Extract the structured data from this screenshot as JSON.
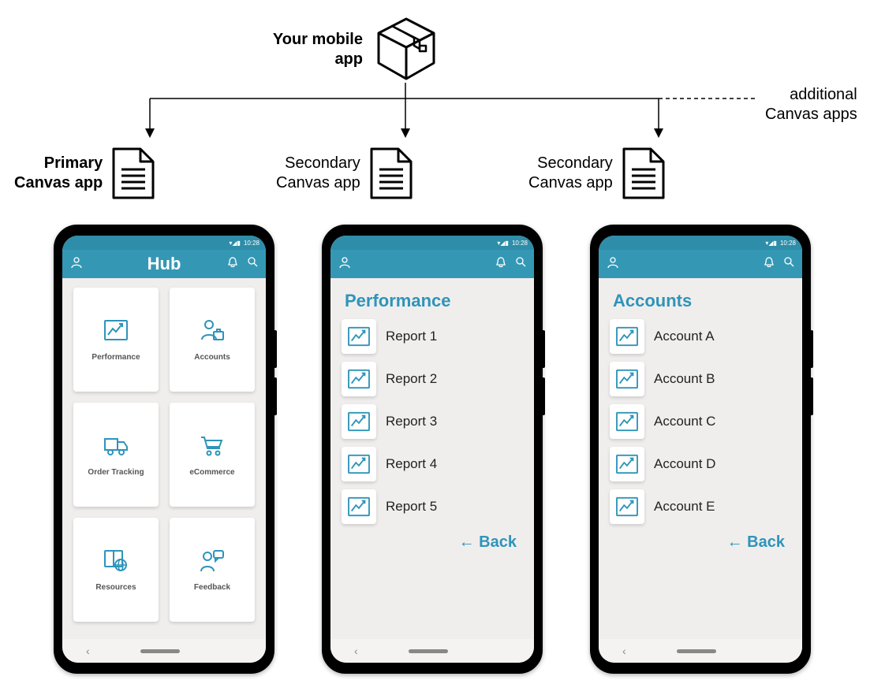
{
  "top": {
    "mobile_app_label": "Your mobile app",
    "additional_label": "additional Canvas apps"
  },
  "docs": [
    {
      "label": "Primary Canvas app",
      "bold": true
    },
    {
      "label": "Secondary Canvas app",
      "bold": false
    },
    {
      "label": "Secondary Canvas app",
      "bold": false
    }
  ],
  "status": {
    "time": "10:28"
  },
  "phones": [
    {
      "header": {
        "title": "Hub",
        "center": true
      },
      "type": "hub",
      "tiles": [
        {
          "icon": "chart",
          "label": "Performance"
        },
        {
          "icon": "person-briefcase",
          "label": "Accounts"
        },
        {
          "icon": "truck",
          "label": "Order Tracking"
        },
        {
          "icon": "cart",
          "label": "eCommerce"
        },
        {
          "icon": "book-globe",
          "label": "Resources"
        },
        {
          "icon": "person-chat",
          "label": "Feedback"
        }
      ]
    },
    {
      "header": {
        "title": "",
        "center": false
      },
      "type": "list",
      "section_title": "Performance",
      "items": [
        "Report 1",
        "Report 2",
        "Report 3",
        "Report 4",
        "Report 5"
      ],
      "back_label": "← Back"
    },
    {
      "header": {
        "title": "",
        "center": false
      },
      "type": "list",
      "section_title": "Accounts",
      "items": [
        "Account A",
        "Account B",
        "Account C",
        "Account D",
        "Account E"
      ],
      "back_label": "← Back"
    }
  ],
  "colors": {
    "accent": "#2e94ba",
    "header": "#3498b5"
  }
}
